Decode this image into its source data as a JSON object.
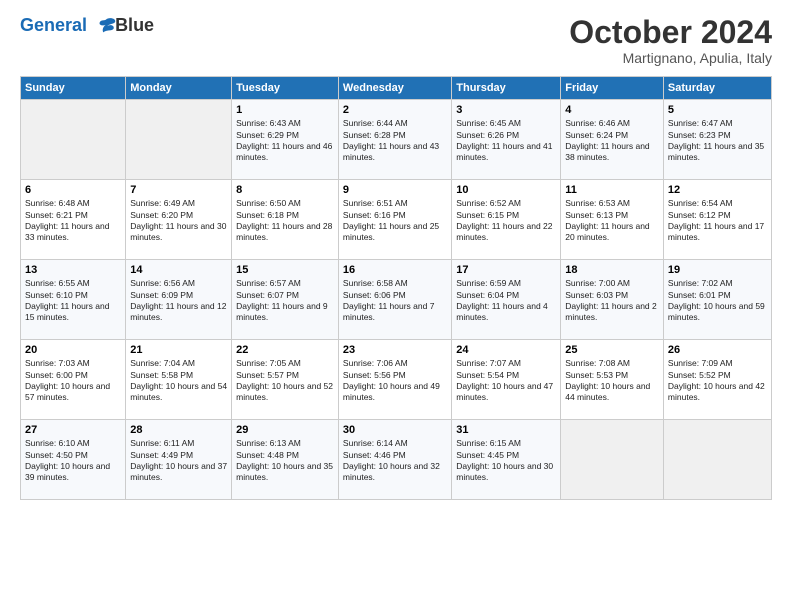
{
  "header": {
    "logo_line1": "General",
    "logo_line2": "Blue",
    "title": "October 2024",
    "subtitle": "Martignano, Apulia, Italy"
  },
  "columns": [
    "Sunday",
    "Monday",
    "Tuesday",
    "Wednesday",
    "Thursday",
    "Friday",
    "Saturday"
  ],
  "weeks": [
    [
      {
        "day": "",
        "text": ""
      },
      {
        "day": "",
        "text": ""
      },
      {
        "day": "1",
        "text": "Sunrise: 6:43 AM\nSunset: 6:29 PM\nDaylight: 11 hours and 46 minutes."
      },
      {
        "day": "2",
        "text": "Sunrise: 6:44 AM\nSunset: 6:28 PM\nDaylight: 11 hours and 43 minutes."
      },
      {
        "day": "3",
        "text": "Sunrise: 6:45 AM\nSunset: 6:26 PM\nDaylight: 11 hours and 41 minutes."
      },
      {
        "day": "4",
        "text": "Sunrise: 6:46 AM\nSunset: 6:24 PM\nDaylight: 11 hours and 38 minutes."
      },
      {
        "day": "5",
        "text": "Sunrise: 6:47 AM\nSunset: 6:23 PM\nDaylight: 11 hours and 35 minutes."
      }
    ],
    [
      {
        "day": "6",
        "text": "Sunrise: 6:48 AM\nSunset: 6:21 PM\nDaylight: 11 hours and 33 minutes."
      },
      {
        "day": "7",
        "text": "Sunrise: 6:49 AM\nSunset: 6:20 PM\nDaylight: 11 hours and 30 minutes."
      },
      {
        "day": "8",
        "text": "Sunrise: 6:50 AM\nSunset: 6:18 PM\nDaylight: 11 hours and 28 minutes."
      },
      {
        "day": "9",
        "text": "Sunrise: 6:51 AM\nSunset: 6:16 PM\nDaylight: 11 hours and 25 minutes."
      },
      {
        "day": "10",
        "text": "Sunrise: 6:52 AM\nSunset: 6:15 PM\nDaylight: 11 hours and 22 minutes."
      },
      {
        "day": "11",
        "text": "Sunrise: 6:53 AM\nSunset: 6:13 PM\nDaylight: 11 hours and 20 minutes."
      },
      {
        "day": "12",
        "text": "Sunrise: 6:54 AM\nSunset: 6:12 PM\nDaylight: 11 hours and 17 minutes."
      }
    ],
    [
      {
        "day": "13",
        "text": "Sunrise: 6:55 AM\nSunset: 6:10 PM\nDaylight: 11 hours and 15 minutes."
      },
      {
        "day": "14",
        "text": "Sunrise: 6:56 AM\nSunset: 6:09 PM\nDaylight: 11 hours and 12 minutes."
      },
      {
        "day": "15",
        "text": "Sunrise: 6:57 AM\nSunset: 6:07 PM\nDaylight: 11 hours and 9 minutes."
      },
      {
        "day": "16",
        "text": "Sunrise: 6:58 AM\nSunset: 6:06 PM\nDaylight: 11 hours and 7 minutes."
      },
      {
        "day": "17",
        "text": "Sunrise: 6:59 AM\nSunset: 6:04 PM\nDaylight: 11 hours and 4 minutes."
      },
      {
        "day": "18",
        "text": "Sunrise: 7:00 AM\nSunset: 6:03 PM\nDaylight: 11 hours and 2 minutes."
      },
      {
        "day": "19",
        "text": "Sunrise: 7:02 AM\nSunset: 6:01 PM\nDaylight: 10 hours and 59 minutes."
      }
    ],
    [
      {
        "day": "20",
        "text": "Sunrise: 7:03 AM\nSunset: 6:00 PM\nDaylight: 10 hours and 57 minutes."
      },
      {
        "day": "21",
        "text": "Sunrise: 7:04 AM\nSunset: 5:58 PM\nDaylight: 10 hours and 54 minutes."
      },
      {
        "day": "22",
        "text": "Sunrise: 7:05 AM\nSunset: 5:57 PM\nDaylight: 10 hours and 52 minutes."
      },
      {
        "day": "23",
        "text": "Sunrise: 7:06 AM\nSunset: 5:56 PM\nDaylight: 10 hours and 49 minutes."
      },
      {
        "day": "24",
        "text": "Sunrise: 7:07 AM\nSunset: 5:54 PM\nDaylight: 10 hours and 47 minutes."
      },
      {
        "day": "25",
        "text": "Sunrise: 7:08 AM\nSunset: 5:53 PM\nDaylight: 10 hours and 44 minutes."
      },
      {
        "day": "26",
        "text": "Sunrise: 7:09 AM\nSunset: 5:52 PM\nDaylight: 10 hours and 42 minutes."
      }
    ],
    [
      {
        "day": "27",
        "text": "Sunrise: 6:10 AM\nSunset: 4:50 PM\nDaylight: 10 hours and 39 minutes."
      },
      {
        "day": "28",
        "text": "Sunrise: 6:11 AM\nSunset: 4:49 PM\nDaylight: 10 hours and 37 minutes."
      },
      {
        "day": "29",
        "text": "Sunrise: 6:13 AM\nSunset: 4:48 PM\nDaylight: 10 hours and 35 minutes."
      },
      {
        "day": "30",
        "text": "Sunrise: 6:14 AM\nSunset: 4:46 PM\nDaylight: 10 hours and 32 minutes."
      },
      {
        "day": "31",
        "text": "Sunrise: 6:15 AM\nSunset: 4:45 PM\nDaylight: 10 hours and 30 minutes."
      },
      {
        "day": "",
        "text": ""
      },
      {
        "day": "",
        "text": ""
      }
    ]
  ]
}
